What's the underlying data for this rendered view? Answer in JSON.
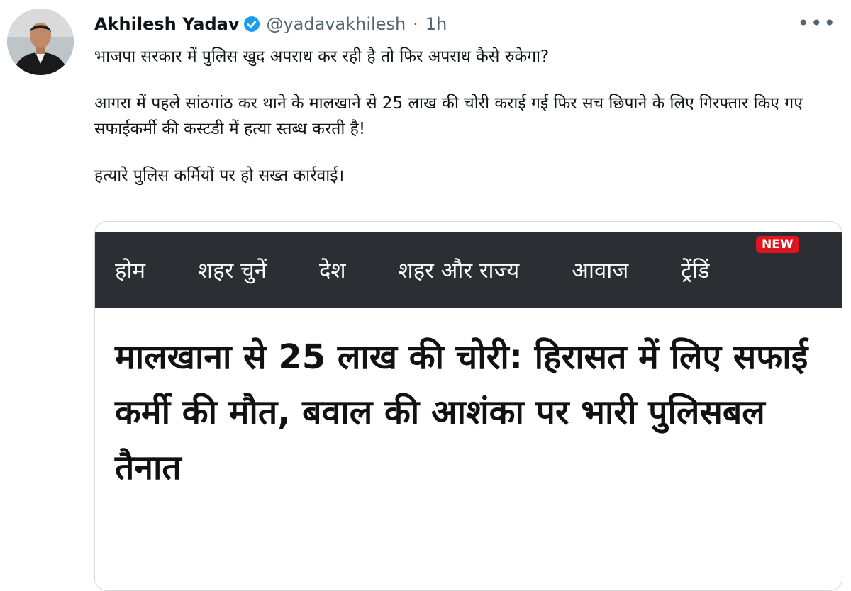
{
  "tweet": {
    "author_name": "Akhilesh Yadav",
    "handle": "@yadavakhilesh",
    "separator": "·",
    "time": "1h",
    "more_label": "•••",
    "paragraphs": [
      "भाजपा सरकार में पुलिस खुद अपराध कर रही है तो फिर अपराध कैसे रुकेगा?",
      "आगरा में पहले सांठगांठ कर थाने के मालखाने से 25 लाख की चोरी कराई गई फिर सच छिपाने के लिए गिरफ्तार किए गए सफाईकर्मी की कस्टडी में हत्या स्तब्ध करती है!",
      "हत्यारे पुलिस कर्मियों पर हो सख्त कार्रवाई।"
    ]
  },
  "card": {
    "nav_items": [
      "होम",
      "शहर चुनें",
      "देश",
      "शहर और राज्य",
      "आवाज",
      "ट्रेंडिं"
    ],
    "new_badge": "NEW",
    "headline": "मालखाना से 25 लाख की चोरी: हिरासत में लिए सफाई कर्मी की मौत, बवाल की आशंका पर भारी पुलिसबल तैनात"
  },
  "icons": {
    "verified": "verified-badge-icon",
    "more": "more-options-icon",
    "avatar": "profile-photo"
  },
  "colors": {
    "verified_blue": "#1d9bf0",
    "text_secondary": "#536471",
    "nav_background": "#2b2f33",
    "badge_red": "#e0161e"
  }
}
